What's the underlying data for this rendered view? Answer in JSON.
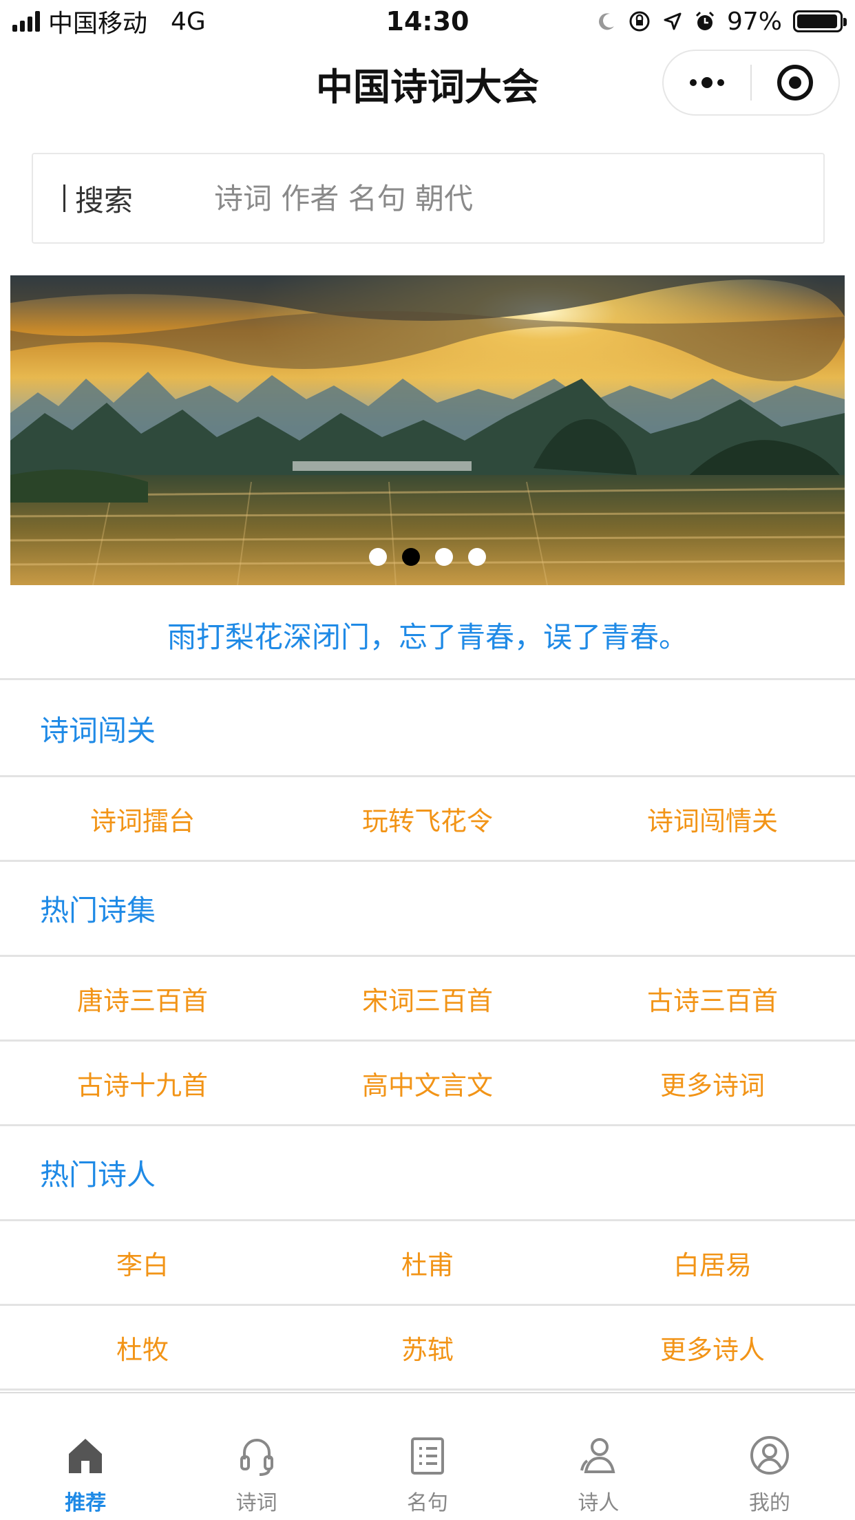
{
  "status_bar": {
    "carrier": "中国移动",
    "network": "4G",
    "time": "14:30",
    "battery_percent": "97%"
  },
  "nav": {
    "title": "中国诗词大会",
    "more_icon": "more-dots-icon",
    "close_icon": "target-icon"
  },
  "search": {
    "label": "搜索",
    "placeholder": "诗词 作者 名句 朝代"
  },
  "banner": {
    "slide_count": 4,
    "active_slide": 2
  },
  "quote": "雨打梨花深闭门，忘了青春，误了青春。",
  "sections": [
    {
      "title": "诗词闯关",
      "rows": [
        [
          "诗词擂台",
          "玩转飞花令",
          "诗词闯情关"
        ]
      ]
    },
    {
      "title": "热门诗集",
      "rows": [
        [
          "唐诗三百首",
          "宋词三百首",
          "古诗三百首"
        ],
        [
          "古诗十九首",
          "高中文言文",
          "更多诗词"
        ]
      ]
    },
    {
      "title": "热门诗人",
      "rows": [
        [
          "李白",
          "杜甫",
          "白居易"
        ],
        [
          "杜牧",
          "苏轼",
          "更多诗人"
        ]
      ]
    }
  ],
  "tabs": [
    {
      "label": "推荐",
      "icon": "home-icon",
      "active": true
    },
    {
      "label": "诗词",
      "icon": "headphones-icon",
      "active": false
    },
    {
      "label": "名句",
      "icon": "list-icon",
      "active": false
    },
    {
      "label": "诗人",
      "icon": "user-icon",
      "active": false
    },
    {
      "label": "我的",
      "icon": "profile-icon",
      "active": false
    }
  ],
  "colors": {
    "accent_blue": "#1f8ae6",
    "accent_orange": "#f29417",
    "divider": "#e3e3e3"
  }
}
